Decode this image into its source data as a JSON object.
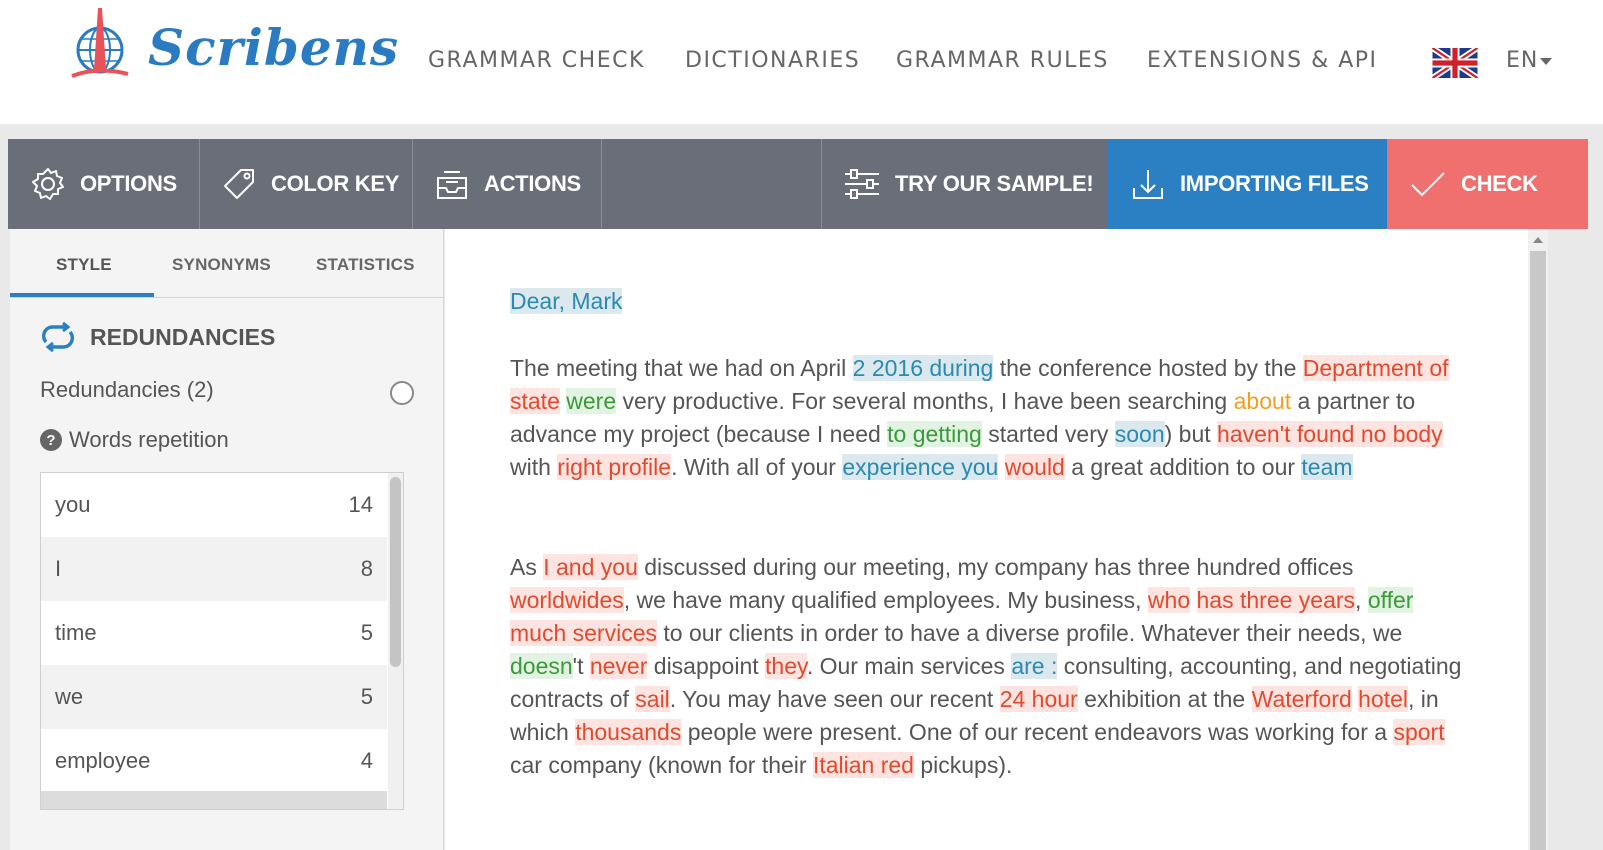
{
  "brand": {
    "name": "Scribens"
  },
  "nav": {
    "items": [
      "GRAMMAR CHECK",
      "DICTIONARIES",
      "GRAMMAR RULES",
      "EXTENSIONS & API"
    ],
    "language": "EN"
  },
  "toolbar": {
    "options": "OPTIONS",
    "color_key": "COLOR KEY",
    "actions": "ACTIONS",
    "sample": "TRY OUR SAMPLE!",
    "import": "IMPORTING FILES",
    "check": "CHECK"
  },
  "colors": {
    "primary_blue": "#2b7fc3",
    "check_red": "#f07070",
    "toolbar_gray": "#6a6e78",
    "highlight_blue": "#2a8ab0",
    "highlight_red": "#e24a2e",
    "highlight_green": "#3a9a3a",
    "highlight_orange": "#f0a020"
  },
  "side_panel": {
    "tabs": [
      "STYLE",
      "SYNONYMS",
      "STATISTICS"
    ],
    "active_tab": "STYLE",
    "section_title": "REDUNDANCIES",
    "redundancies_label": "Redundancies (2)",
    "words_repetition_label": "Words repetition",
    "words": [
      {
        "word": "you",
        "count": "14"
      },
      {
        "word": "I",
        "count": "8"
      },
      {
        "word": "time",
        "count": "5"
      },
      {
        "word": "we",
        "count": "5"
      },
      {
        "word": "employee",
        "count": "4"
      }
    ]
  },
  "document": {
    "paragraphs": [
      [
        {
          "t": "Dear, Mark",
          "c": "b"
        }
      ],
      [
        {
          "t": "The meeting that we had on April "
        },
        {
          "t": "2 2016 during",
          "c": "b"
        },
        {
          "t": " the conference hosted by the "
        },
        {
          "t": "Department of state",
          "c": "r"
        },
        {
          "t": " "
        },
        {
          "t": "were",
          "c": "g"
        },
        {
          "t": " very productive. For several months, I have been searching "
        },
        {
          "t": "about",
          "c": "o"
        },
        {
          "t": " a partner to advance my project (because I need "
        },
        {
          "t": "to getting",
          "c": "g"
        },
        {
          "t": " started very "
        },
        {
          "t": "soon",
          "c": "b"
        },
        {
          "t": ") but "
        },
        {
          "t": "haven't found no body",
          "c": "r"
        },
        {
          "t": " with "
        },
        {
          "t": "right profile",
          "c": "r"
        },
        {
          "t": ". With all of your "
        },
        {
          "t": "experience you",
          "c": "b"
        },
        {
          "t": " "
        },
        {
          "t": "would",
          "c": "r"
        },
        {
          "t": " a great addition to our "
        },
        {
          "t": "team",
          "c": "b"
        }
      ],
      [
        {
          "t": "As "
        },
        {
          "t": "I and you",
          "c": "r"
        },
        {
          "t": " discussed during our meeting, my company has three hundred offices "
        },
        {
          "t": "worldwides",
          "c": "r"
        },
        {
          "t": ", we have many qualified employees. My business, "
        },
        {
          "t": "who",
          "c": "r"
        },
        {
          "t": " "
        },
        {
          "t": "has three years",
          "c": "r"
        },
        {
          "t": ", "
        },
        {
          "t": "offer",
          "c": "g"
        },
        {
          "t": " "
        },
        {
          "t": "much services",
          "c": "r"
        },
        {
          "t": " to our clients in order to have a diverse profile. Whatever their needs, we "
        },
        {
          "t": "doesn",
          "c": "g"
        },
        {
          "t": "'t "
        },
        {
          "t": "never",
          "c": "r"
        },
        {
          "t": " disappoint "
        },
        {
          "t": "they",
          "c": "r"
        },
        {
          "t": ". Our main services "
        },
        {
          "t": "are :",
          "c": "b"
        },
        {
          "t": " consulting, accounting, and negotiating contracts of "
        },
        {
          "t": "sail",
          "c": "r"
        },
        {
          "t": ". You may have seen our recent "
        },
        {
          "t": "24 hour",
          "c": "r"
        },
        {
          "t": " exhibition at the "
        },
        {
          "t": "Waterford",
          "c": "r"
        },
        {
          "t": " "
        },
        {
          "t": "hotel",
          "c": "r"
        },
        {
          "t": ", in which "
        },
        {
          "t": "thousands",
          "c": "r"
        },
        {
          "t": " people were present. One of our recent endeavors was working for a "
        },
        {
          "t": "sport",
          "c": "r"
        },
        {
          "t": " car company (known for their "
        },
        {
          "t": "Italian red",
          "c": "r"
        },
        {
          "t": " pickups)."
        }
      ]
    ]
  }
}
